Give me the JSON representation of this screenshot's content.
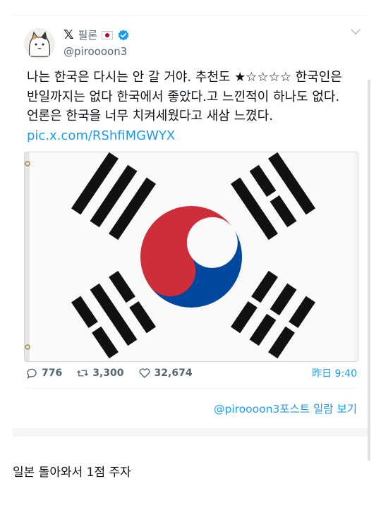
{
  "tweet": {
    "x_logo": "𝕏",
    "display_name": "필론",
    "flag_icon": "japan-flag-icon",
    "handle": "@piroooon3",
    "lines": [
      "나는 한국은 다시는 안 갈 거야. 추천도 ★☆☆☆☆ 한국인은",
      "반일까지는 없다 한국에서 좋았다.고 느낀적이 하나도 없다.",
      "언론은 한국을 너무 치켜세웠다고 새삼 느꼈다."
    ],
    "link": "pic.x.com/RShfiMGWYX",
    "actions": {
      "replies": "776",
      "retweets": "3,300",
      "likes": "32,674"
    },
    "timestamp": "昨日 9:40",
    "view_more": "@piroooon3포스트 일람 보기"
  },
  "caption": "일본 돌아와서  1점 주자",
  "colors": {
    "accent": "#1d9bf0",
    "flag_red": "#cd2e3a",
    "flag_blue": "#0047a0"
  }
}
